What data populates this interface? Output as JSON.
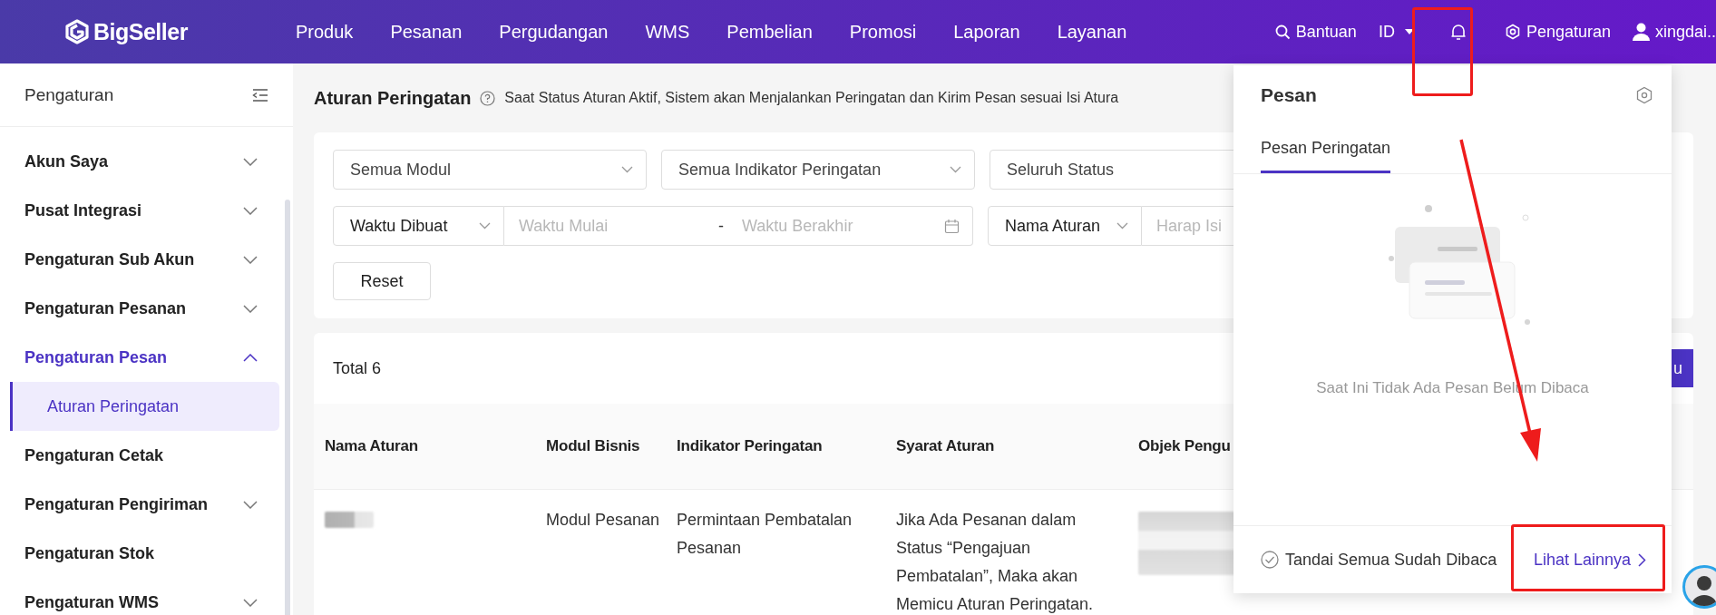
{
  "topbar": {
    "logo": "BigSeller",
    "nav": [
      "Produk",
      "Pesanan",
      "Pergudangan",
      "WMS",
      "Pembelian",
      "Promosi",
      "Laporan",
      "Layanan"
    ],
    "help": "Bantuan",
    "language": "ID",
    "settings": "Pengaturan",
    "user": "xingdai.."
  },
  "sidebar": {
    "title": "Pengaturan",
    "items": [
      {
        "label": "Akun Saya",
        "expandable": true,
        "expanded": false,
        "selected": false
      },
      {
        "label": "Pusat Integrasi",
        "expandable": true,
        "expanded": false,
        "selected": false
      },
      {
        "label": "Pengaturan Sub Akun",
        "expandable": true,
        "expanded": false,
        "selected": false
      },
      {
        "label": "Pengaturan Pesanan",
        "expandable": true,
        "expanded": false,
        "selected": false
      },
      {
        "label": "Pengaturan Pesan",
        "expandable": true,
        "expanded": true,
        "selected": true,
        "children": [
          {
            "label": "Aturan Peringatan",
            "selected": true
          }
        ]
      },
      {
        "label": "Pengaturan Cetak",
        "expandable": false,
        "selected": false
      },
      {
        "label": "Pengaturan Pengiriman",
        "expandable": true,
        "expanded": false,
        "selected": false
      },
      {
        "label": "Pengaturan Stok",
        "expandable": false,
        "selected": false
      },
      {
        "label": "Pengaturan WMS",
        "expandable": true,
        "expanded": false,
        "selected": false
      }
    ]
  },
  "page": {
    "title": "Aturan Peringatan",
    "description": "Saat Status Aturan Aktif, Sistem akan Menjalankan Peringatan dan Kirim Pesan sesuai Isi Atura"
  },
  "filters": {
    "module": "Semua Modul",
    "indicator": "Semua Indikator Peringatan",
    "status": "Seluruh Status",
    "time_type": "Waktu Dibuat",
    "start_placeholder": "Waktu Mulai",
    "separator": "-",
    "end_placeholder": "Waktu Berakhir",
    "search_type": "Nama Aturan",
    "search_placeholder": "Harap Isi",
    "reset": "Reset"
  },
  "table": {
    "total": "Total 6",
    "action_button": "u",
    "columns": [
      "Nama Aturan",
      "Modul Bisnis",
      "Indikator Peringatan",
      "Syarat Aturan",
      "Objek Pengu"
    ],
    "rows": [
      {
        "cells": [
          {
            "kind": "redacted"
          },
          {
            "kind": "text",
            "text": "Modul Pesanan"
          },
          {
            "kind": "text",
            "text": "Permintaan Pembatalan Pesanan"
          },
          {
            "kind": "text",
            "text": "Jika Ada Pesanan dalam Status “Pengajuan Pembatalan”, Maka akan Memicu Aturan Peringatan."
          },
          {
            "kind": "redacted"
          }
        ]
      }
    ]
  },
  "popup": {
    "title": "Pesan",
    "tabs": [
      {
        "label": "Pesan Peringatan",
        "selected": true
      }
    ],
    "empty_text": "Saat Ini Tidak Ada Pesan Belum Dibaca",
    "mark_all": "Tandai Semua Sudah Dibaca",
    "more": "Lihat Lainnya"
  }
}
